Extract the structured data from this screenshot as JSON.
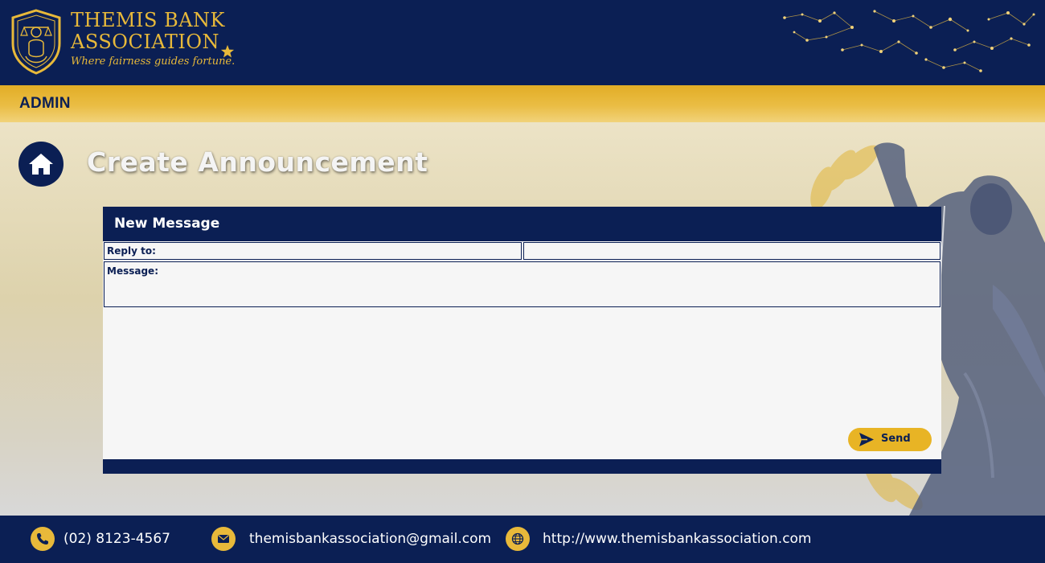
{
  "brand": {
    "name_line1": "THEMIS BANK",
    "name_line2": "ASSOCIATION",
    "tagline": "Where fairness guides fortune."
  },
  "admin_bar": {
    "label": "ADMIN"
  },
  "page": {
    "title": "Create Announcement"
  },
  "form": {
    "header": "New Message",
    "reply_to_label": "Reply to:",
    "reply_to_value": "",
    "message_label": "Message:",
    "message_value": "",
    "send_label": "Send"
  },
  "footer": {
    "phone": "(02) 8123-4567",
    "email": "themisbankassociation@gmail.com",
    "website": "http://www.themisbankassociation.com"
  },
  "colors": {
    "navy": "#0b1f54",
    "gold": "#e8b425",
    "panel": "#f6f6f6"
  },
  "icons": [
    "shield-logo-icon",
    "star-icon",
    "constellation-decoration",
    "home-icon",
    "send-icon",
    "phone-icon",
    "mail-icon",
    "globe-icon",
    "statue-decoration"
  ]
}
